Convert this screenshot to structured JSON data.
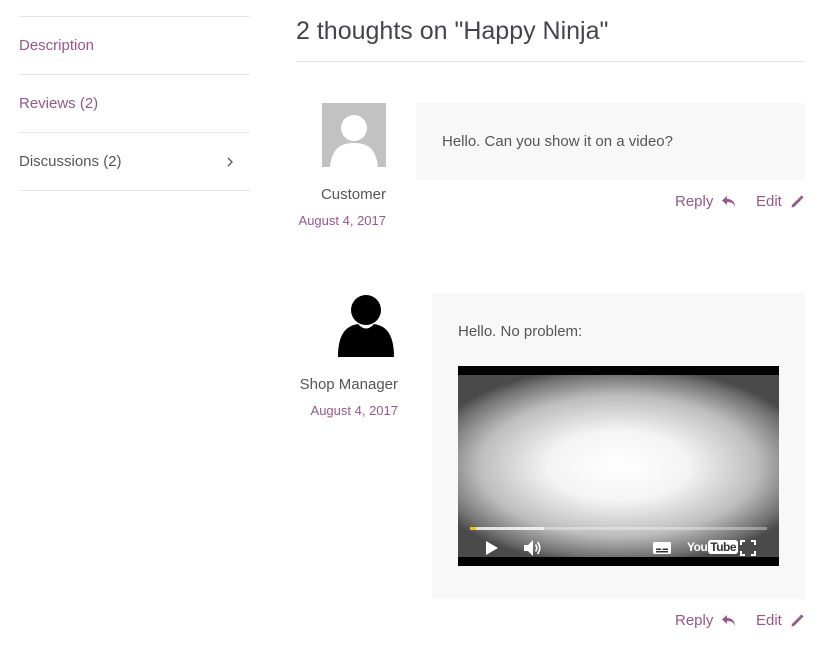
{
  "tabs": [
    {
      "label": "Description"
    },
    {
      "label": "Reviews (2)"
    },
    {
      "label": "Discussions (2)"
    }
  ],
  "discussion": {
    "title": "2 thoughts on \"Happy Ninja\"",
    "comments": [
      {
        "author": "Customer",
        "date": "August 4, 2017",
        "text": "Hello. Can you show it on a video?",
        "reply_label": "Reply",
        "edit_label": "Edit"
      },
      {
        "author": "Shop Manager",
        "date": "August 4, 2017",
        "text": "Hello. No problem:",
        "reply_label": "Reply",
        "edit_label": "Edit",
        "video": {
          "controls": [
            "play-icon",
            "volume-icon",
            "subtitles-icon",
            "youtube-logo",
            "fullscreen-icon"
          ],
          "youtube_text": "YouTube"
        }
      }
    ]
  },
  "colors": {
    "accent": "#96588a",
    "text": "#555555",
    "bubble": "#f8f8f8",
    "divider": "#e6e6e6"
  }
}
